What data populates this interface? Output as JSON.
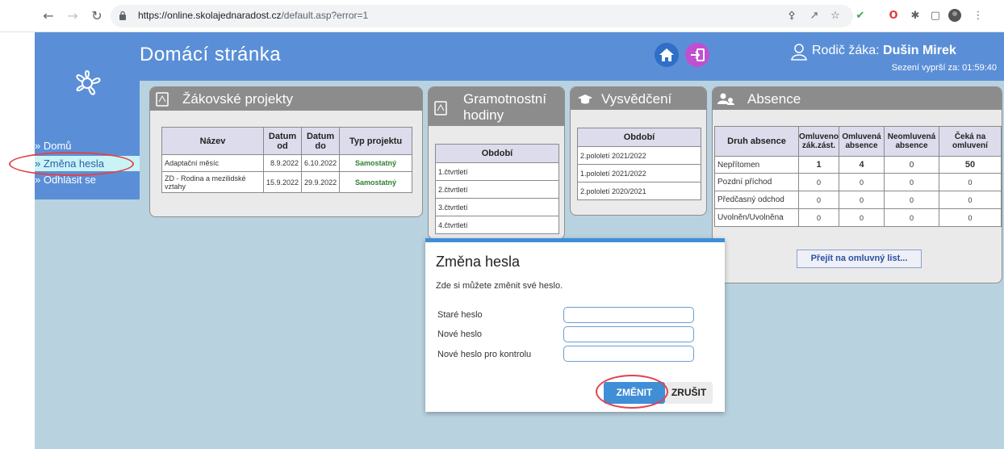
{
  "browser": {
    "url_host": "https://online.skolajednaradost.cz",
    "url_path": "/default.asp?error=1"
  },
  "header": {
    "title": "Domácí stránka",
    "user_prefix": "Rodič žáka: ",
    "user_name": "Dušin Mirek",
    "session": "Sezení vyprší za: 01:59:40"
  },
  "leftnav": {
    "items": [
      {
        "label": "» Domů"
      },
      {
        "label": "» Změna hesla"
      },
      {
        "label": "» Odhlásit se"
      }
    ]
  },
  "projects": {
    "title": "Žákovské projekty",
    "headers": [
      "Název",
      "Datum od",
      "Datum do",
      "Typ projektu"
    ],
    "rows": [
      [
        "Adaptační měsíc",
        "8.9.2022",
        "6.10.2022",
        "Samostatný"
      ],
      [
        "ZD - Rodina a mezilidské vztahy",
        "15.9.2022",
        "29.9.2022",
        "Samostatný"
      ]
    ]
  },
  "literacy": {
    "title": "Gramotnostní hodiny",
    "header": "Období",
    "rows": [
      "1.čtvrtletí",
      "2.čtvrtletí",
      "3.čtvrtletí",
      "4.čtvrtletí"
    ]
  },
  "report": {
    "title": "Vysvědčení",
    "header": "Období",
    "rows": [
      "2.pololetí 2021/2022",
      "1.pololetí 2021/2022",
      "2.pololetí 2020/2021"
    ]
  },
  "absence": {
    "title": "Absence",
    "headers": [
      "Druh absence",
      "Omluveno zák.zást.",
      "Omluvená absence",
      "Neomluvená absence",
      "Čeká na omluvení"
    ],
    "rows": [
      [
        "Nepřítomen",
        "1",
        "4",
        "0",
        "50"
      ],
      [
        "Pozdní příchod",
        "0",
        "0",
        "0",
        "0"
      ],
      [
        "Předčasný odchod",
        "0",
        "0",
        "0",
        "0"
      ],
      [
        "Uvolněn/Uvolněna",
        "0",
        "0",
        "0",
        "0"
      ]
    ],
    "link": "Přejít na omluvný list..."
  },
  "dialog": {
    "title": "Změna hesla",
    "description": "Zde si můžete změnit své heslo.",
    "fields": [
      {
        "label": "Staré heslo",
        "value": ""
      },
      {
        "label": "Nové heslo",
        "value": ""
      },
      {
        "label": "Nové heslo pro kontrolu",
        "value": ""
      }
    ],
    "confirm": "ZMĚNIT",
    "cancel": "ZRUŠIT"
  },
  "colors": {
    "header_bg": "#5a8fd7",
    "page_bg": "#b9d2e0",
    "accent": "#3f8ed6",
    "highlight": "#e0444b"
  }
}
